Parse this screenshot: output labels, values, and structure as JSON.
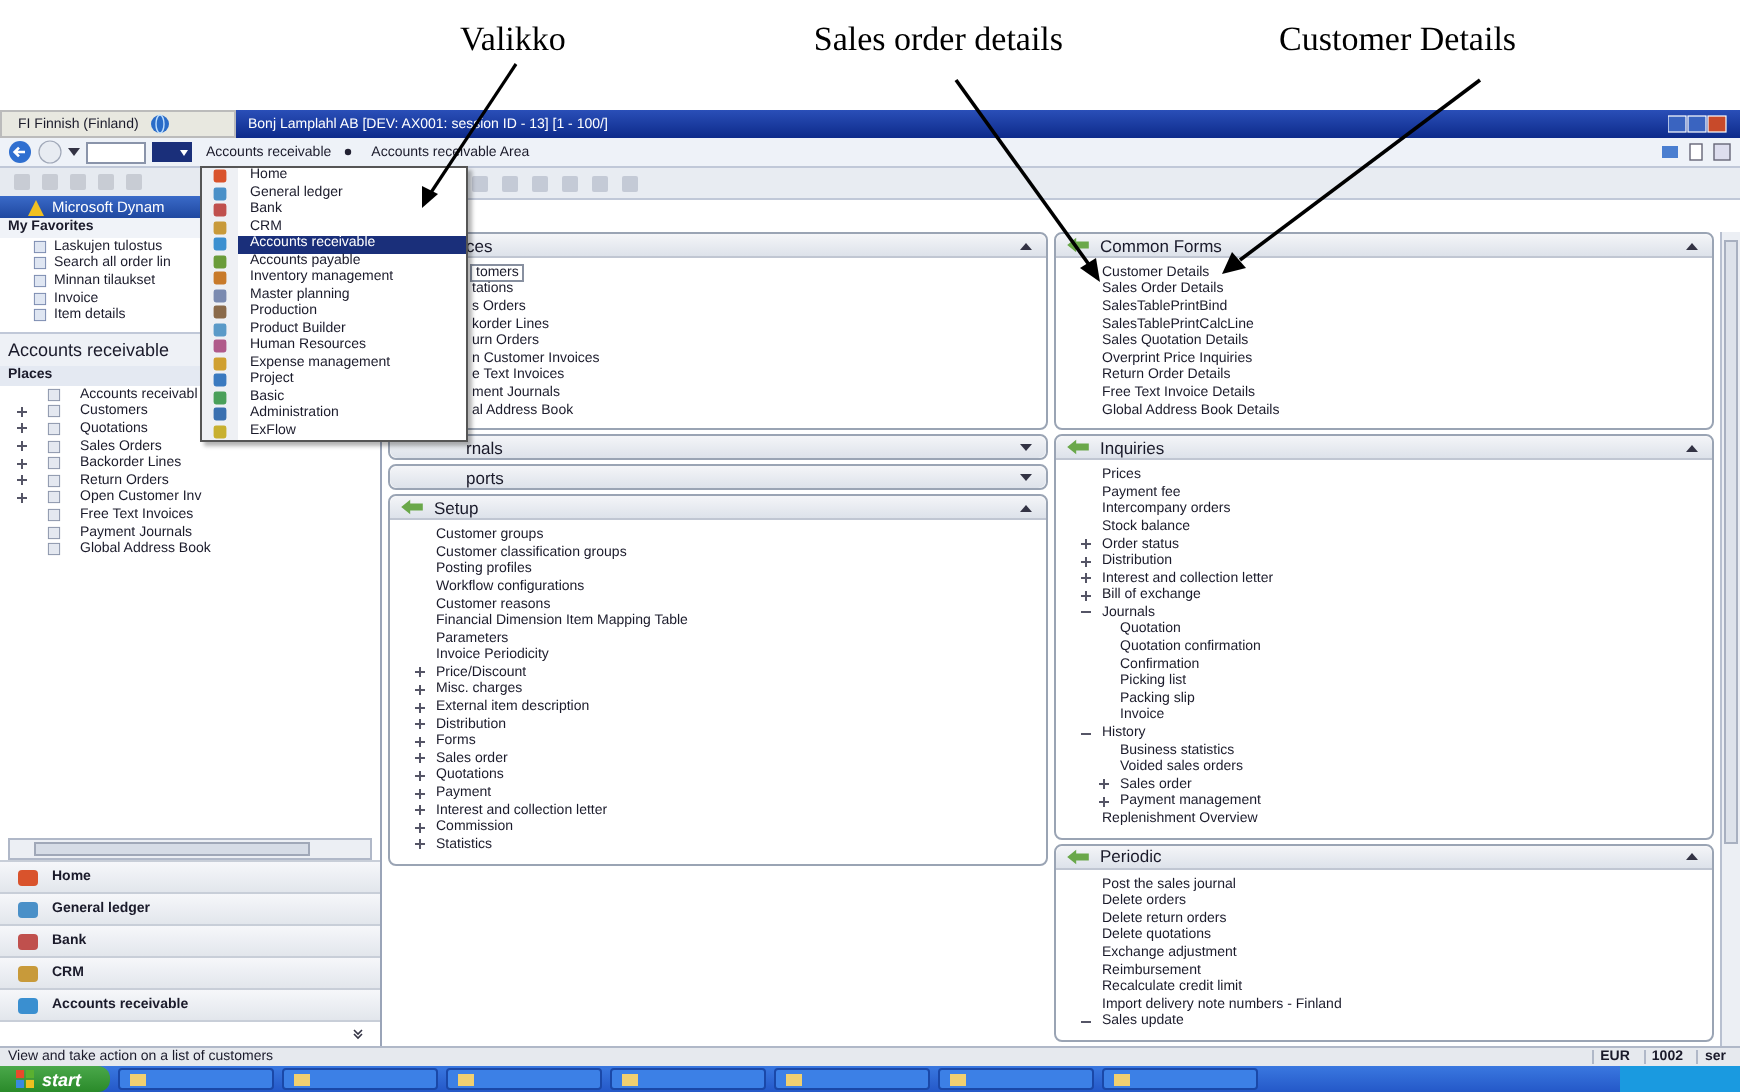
{
  "annotations": [
    {
      "label": "Valikko"
    },
    {
      "label": "Sales order details"
    },
    {
      "label": "Customer Details"
    }
  ],
  "language_bar": {
    "label": "FI Finnish (Finland)"
  },
  "window": {
    "title": "Bonj Lamplahl AB [DEV: AX001: session ID - 13] [1 - 100/]"
  },
  "address_bar": {
    "breadcrumbs": [
      "Accounts receivable",
      "Accounts receivable Area"
    ]
  },
  "nav_pane": {
    "header": "Microsoft Dynam",
    "favorites_title": "My Favorites",
    "favorites": [
      "Laskujen tulostus",
      "Search all order lin",
      "Minnan tilaukset",
      "Invoice",
      "Item details"
    ],
    "module_title": "Accounts receivable",
    "places_title": "Places",
    "places": [
      {
        "label": "Accounts receivabl",
        "kind": "link"
      },
      {
        "label": "Customers",
        "kind": "group",
        "expanded": false
      },
      {
        "label": "Quotations",
        "kind": "group",
        "expanded": false
      },
      {
        "label": "Sales Orders",
        "kind": "group",
        "expanded": false
      },
      {
        "label": "Backorder Lines",
        "kind": "group",
        "expanded": false
      },
      {
        "label": "Return Orders",
        "kind": "group",
        "expanded": false
      },
      {
        "label": "Open Customer Inv",
        "kind": "group",
        "expanded": false
      },
      {
        "label": "Free Text Invoices",
        "kind": "link"
      },
      {
        "label": "Payment Journals",
        "kind": "link"
      },
      {
        "label": "Global Address Book",
        "kind": "link"
      }
    ],
    "modules": [
      "Home",
      "General ledger",
      "Bank",
      "CRM",
      "Accounts receivable"
    ]
  },
  "module_menu": {
    "items": [
      {
        "label": "Home",
        "selected": false
      },
      {
        "label": "General ledger",
        "selected": false
      },
      {
        "label": "Bank",
        "selected": false
      },
      {
        "label": "CRM",
        "selected": false
      },
      {
        "label": "Accounts receivable",
        "selected": true
      },
      {
        "label": "Accounts payable",
        "selected": false
      },
      {
        "label": "Inventory management",
        "selected": false
      },
      {
        "label": "Master planning",
        "selected": false
      },
      {
        "label": "Production",
        "selected": false
      },
      {
        "label": "Product Builder",
        "selected": false
      },
      {
        "label": "Human Resources",
        "selected": false
      },
      {
        "label": "Expense management",
        "selected": false
      },
      {
        "label": "Project",
        "selected": false
      },
      {
        "label": "Basic",
        "selected": false
      },
      {
        "label": "Administration",
        "selected": false
      },
      {
        "label": "ExFlow",
        "selected": false
      }
    ]
  },
  "left_column": {
    "panels": [
      {
        "title": "ces",
        "expanded": true,
        "items": [
          {
            "label": "tomers",
            "kind": "link",
            "selected": true
          },
          {
            "label": "tations",
            "kind": "link",
            "selected": false
          },
          {
            "label": "s Orders",
            "kind": "link",
            "selected": false
          },
          {
            "label": "korder Lines",
            "kind": "link",
            "selected": false
          },
          {
            "label": "urn Orders",
            "kind": "link",
            "selected": false
          },
          {
            "label": "n Customer Invoices",
            "kind": "link",
            "selected": false
          },
          {
            "label": "e Text Invoices",
            "kind": "link",
            "selected": false
          },
          {
            "label": "ment Journals",
            "kind": "link",
            "selected": false
          },
          {
            "label": "al Address Book",
            "kind": "link",
            "selected": false
          }
        ]
      },
      {
        "title": "rnals",
        "expanded": false
      },
      {
        "title": "ports",
        "expanded": false
      },
      {
        "title": "Setup",
        "expanded": true,
        "items": [
          {
            "label": "Customer groups",
            "kind": "link"
          },
          {
            "label": "Customer classification groups",
            "kind": "link"
          },
          {
            "label": "Posting profiles",
            "kind": "link"
          },
          {
            "label": "Workflow configurations",
            "kind": "link"
          },
          {
            "label": "Customer reasons",
            "kind": "link"
          },
          {
            "label": "Financial Dimension Item Mapping Table",
            "kind": "link"
          },
          {
            "label": "Parameters",
            "kind": "link"
          },
          {
            "label": "Invoice Periodicity",
            "kind": "link"
          },
          {
            "label": "Price/Discount",
            "kind": "group",
            "expanded": false
          },
          {
            "label": "Misc. charges",
            "kind": "group",
            "expanded": false
          },
          {
            "label": "External item description",
            "kind": "group",
            "expanded": false
          },
          {
            "label": "Distribution",
            "kind": "group",
            "expanded": false
          },
          {
            "label": "Forms",
            "kind": "group",
            "expanded": false
          },
          {
            "label": "Sales order",
            "kind": "group",
            "expanded": false
          },
          {
            "label": "Quotations",
            "kind": "group",
            "expanded": false
          },
          {
            "label": "Payment",
            "kind": "group",
            "expanded": false
          },
          {
            "label": "Interest and collection letter",
            "kind": "group",
            "expanded": false
          },
          {
            "label": "Commission",
            "kind": "group",
            "expanded": false
          },
          {
            "label": "Statistics",
            "kind": "group",
            "expanded": false
          }
        ]
      }
    ]
  },
  "right_column": {
    "panels": [
      {
        "title": "Common Forms",
        "expanded": true,
        "items": [
          {
            "label": "Customer Details",
            "kind": "link"
          },
          {
            "label": "Sales Order Details",
            "kind": "link"
          },
          {
            "label": "SalesTablePrintBind",
            "kind": "link"
          },
          {
            "label": "SalesTablePrintCalcLine",
            "kind": "link"
          },
          {
            "label": "Sales Quotation Details",
            "kind": "link"
          },
          {
            "label": "Overprint Price Inquiries",
            "kind": "link"
          },
          {
            "label": "Return Order Details",
            "kind": "link"
          },
          {
            "label": "Free Text Invoice Details",
            "kind": "link"
          },
          {
            "label": "Global Address Book Details",
            "kind": "link"
          }
        ]
      },
      {
        "title": "Inquiries",
        "expanded": true,
        "items": [
          {
            "label": "Prices",
            "kind": "link"
          },
          {
            "label": "Payment fee",
            "kind": "link"
          },
          {
            "label": "Intercompany orders",
            "kind": "link"
          },
          {
            "label": "Stock balance",
            "kind": "link"
          },
          {
            "label": "Order status",
            "kind": "group",
            "expanded": false
          },
          {
            "label": "Distribution",
            "kind": "group",
            "expanded": false
          },
          {
            "label": "Interest and collection letter",
            "kind": "group",
            "expanded": false
          },
          {
            "label": "Bill of exchange",
            "kind": "group",
            "expanded": false
          },
          {
            "label": "Journals",
            "kind": "group",
            "expanded": true,
            "children": [
              {
                "label": "Quotation",
                "kind": "link"
              },
              {
                "label": "Quotation confirmation",
                "kind": "link"
              },
              {
                "label": "Confirmation",
                "kind": "link"
              },
              {
                "label": "Picking list",
                "kind": "link"
              },
              {
                "label": "Packing slip",
                "kind": "link"
              },
              {
                "label": "Invoice",
                "kind": "link"
              }
            ]
          },
          {
            "label": "History",
            "kind": "group",
            "expanded": true,
            "children": [
              {
                "label": "Business statistics",
                "kind": "link"
              },
              {
                "label": "Voided sales orders",
                "kind": "link"
              },
              {
                "label": "Sales order",
                "kind": "group",
                "expanded": false
              },
              {
                "label": "Payment management",
                "kind": "group",
                "expanded": false
              }
            ]
          },
          {
            "label": "Replenishment Overview",
            "kind": "link"
          }
        ]
      },
      {
        "title": "Periodic",
        "expanded": true,
        "items": [
          {
            "label": "Post the sales journal",
            "kind": "link"
          },
          {
            "label": "Delete orders",
            "kind": "link"
          },
          {
            "label": "Delete return orders",
            "kind": "link"
          },
          {
            "label": "Delete quotations",
            "kind": "link"
          },
          {
            "label": "Exchange adjustment",
            "kind": "link"
          },
          {
            "label": "Reimbursement",
            "kind": "link"
          },
          {
            "label": "Recalculate credit limit",
            "kind": "link"
          },
          {
            "label": "Import delivery note numbers - Finland",
            "kind": "link"
          },
          {
            "label": "Sales update",
            "kind": "group",
            "expanded": true
          }
        ]
      }
    ]
  },
  "status_bar": {
    "text": "View and take action on a list of customers",
    "fields": [
      "EUR",
      "1002",
      "ser"
    ]
  },
  "taskbar": {
    "start": "start"
  }
}
